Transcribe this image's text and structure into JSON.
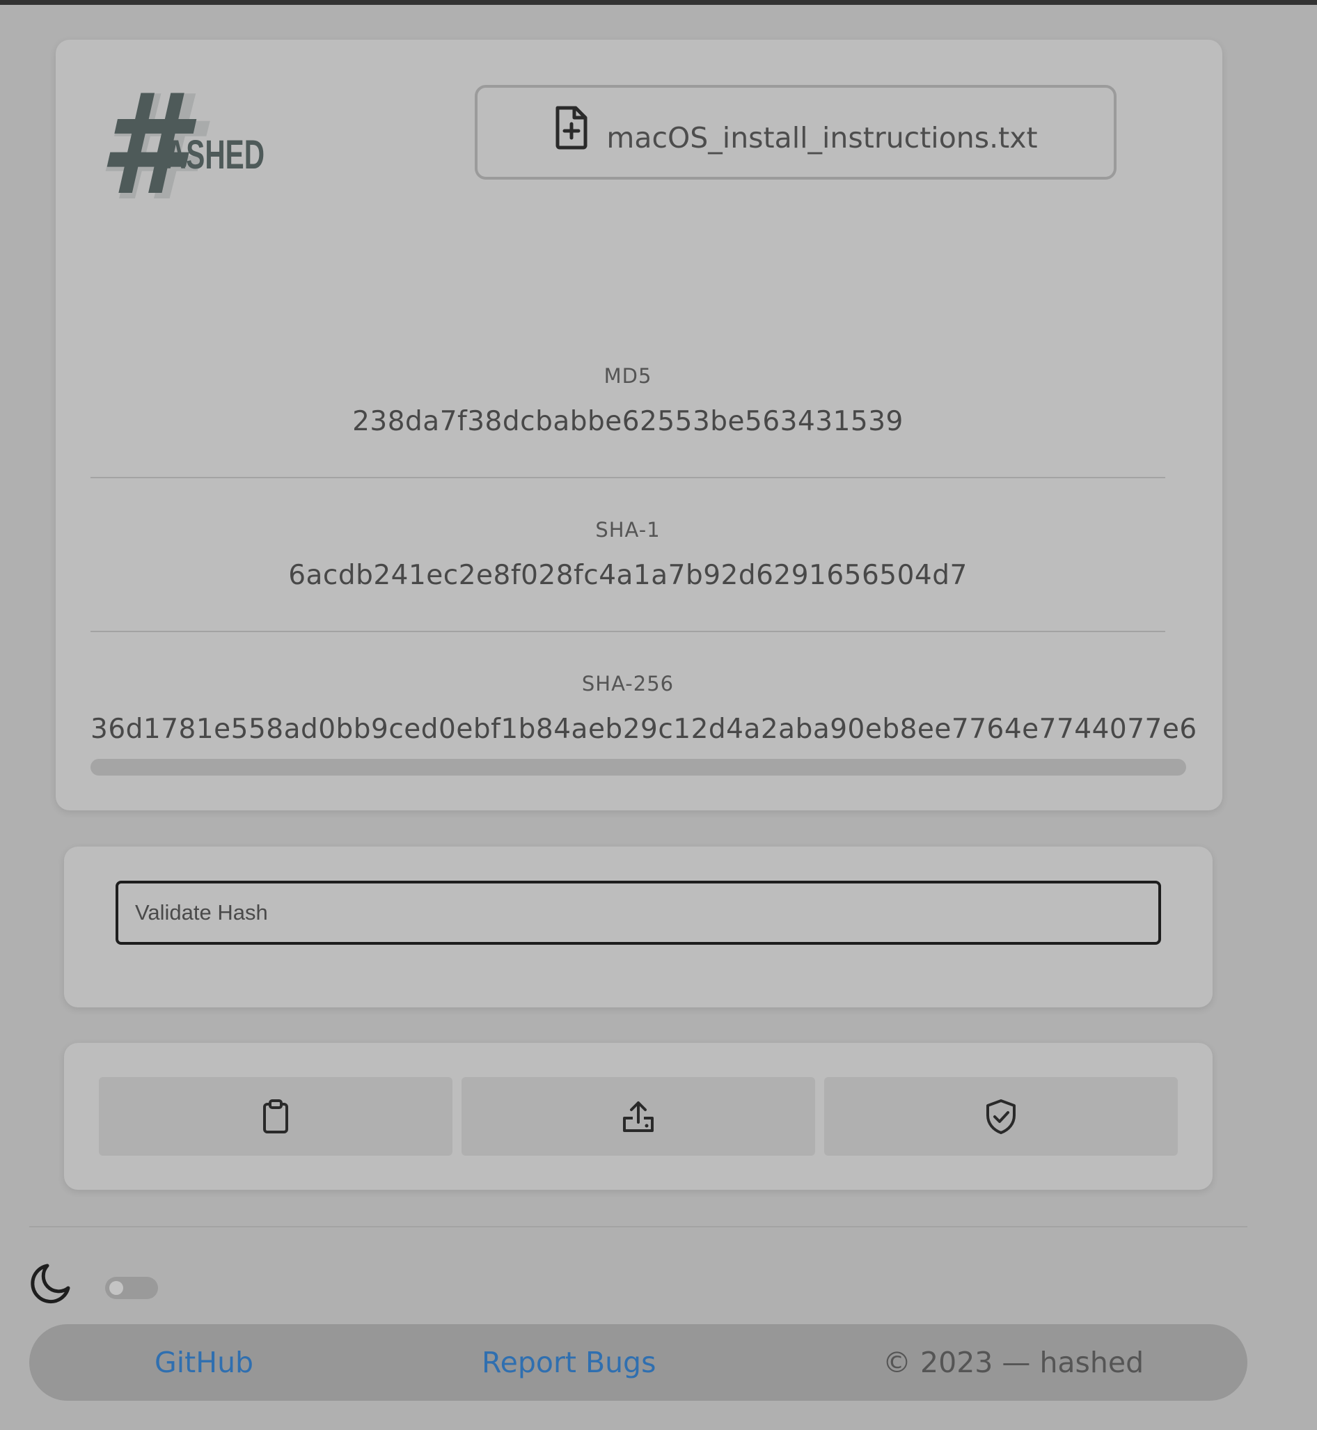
{
  "app": {
    "logo_text": "ASHED",
    "logo_glyph": "#"
  },
  "file": {
    "name": "macOS_install_instructions.txt",
    "icon": "file-plus-icon"
  },
  "hashes": [
    {
      "label": "MD5",
      "value": "238da7f38dcbabbe62553be563431539"
    },
    {
      "label": "SHA-1",
      "value": "6acdb241ec2e8f028fc4a1a7b92d6291656504d7"
    },
    {
      "label": "SHA-256",
      "value": "36d1781e558ad0bb9ced0ebf1b84aeb29c12d4a2aba90eb8ee7764e7744077e6"
    }
  ],
  "validate": {
    "placeholder": "Validate Hash",
    "value": ""
  },
  "actions": [
    {
      "icon": "clipboard-icon"
    },
    {
      "icon": "share-upload-icon"
    },
    {
      "icon": "shield-check-icon"
    }
  ],
  "theme": {
    "icon": "moon-icon",
    "dark_mode": false
  },
  "footer": {
    "github": "GitHub",
    "report_bugs": "Report Bugs",
    "copyright": "© 2023 — hashed"
  },
  "colors": {
    "logo": "#4e5a59",
    "link": "#2f6fb0",
    "card": "#bdbdbd",
    "background": "#b0b0b0"
  }
}
